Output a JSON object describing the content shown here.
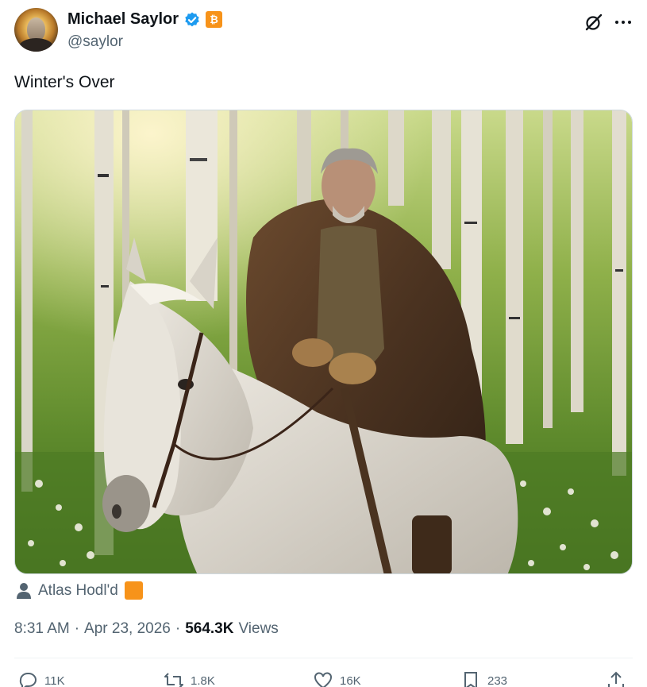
{
  "author": {
    "display_name": "Michael Saylor",
    "handle": "@saylor",
    "verified": true,
    "badge_symbol": "₿",
    "badge_color": "#f7931a",
    "verified_color": "#1d9bf0"
  },
  "tweet": {
    "text": "Winter's Over",
    "tagged_user": "Atlas Hodl'd",
    "time": "8:31 AM",
    "separator": "·",
    "date": "Apr 23, 2026",
    "views_count": "564.3K",
    "views_label": "Views"
  },
  "icons": {
    "grok": "grok-icon",
    "more": "more-icon",
    "tag": "user-icon",
    "reply": "reply-icon",
    "retweet": "retweet-icon",
    "like": "like-icon",
    "bookmark": "bookmark-icon",
    "share": "share-icon"
  },
  "actions": {
    "reply_count": "11K",
    "retweet_count": "1.8K",
    "like_count": "16K",
    "bookmark_count": "233"
  },
  "colors": {
    "text_primary": "#0f1419",
    "text_secondary": "#536471",
    "accent_orange": "#f7931a"
  }
}
